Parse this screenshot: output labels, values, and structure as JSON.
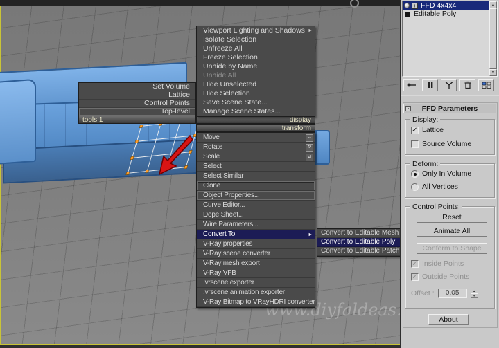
{
  "icons": {
    "submenu_arrow": "►",
    "checkmark": "✓",
    "expand_plus": "+",
    "collapse_minus": "-",
    "spinner_up": "▲",
    "spinner_down": "▼",
    "move_glyph": "↔",
    "rotate_glyph": "↻",
    "scale_glyph": "⊿"
  },
  "viewport": {
    "watermark": "www.diyfaldeas.com",
    "left_quad": {
      "header": "tools 1",
      "items": [
        "Set Volume",
        "Lattice",
        "Control Points",
        "Top-level"
      ]
    },
    "display_header": "display",
    "transform_header": "transform",
    "display_menu": [
      "Viewport Lighting and Shadows",
      "Isolate Selection",
      "Unfreeze All",
      "Freeze Selection",
      "Unhide by Name",
      "Unhide All",
      "Hide Unselected",
      "Hide Selection",
      "Save Scene State...",
      "Manage Scene States..."
    ],
    "transform_menu": [
      "Move",
      "Rotate",
      "Scale",
      "Select",
      "Select Similar",
      "Clone",
      "Object Properties...",
      "Curve Editor...",
      "Dope Sheet...",
      "Wire Parameters...",
      "Convert To:",
      "V-Ray properties",
      "V-Ray scene converter",
      "V-Ray mesh export",
      "V-Ray VFB",
      ".vrscene exporter",
      ".vrscene animation exporter",
      "V-Ray Bitmap to VRayHDRI converter"
    ],
    "convert_submenu": [
      "Convert to Editable Mesh",
      "Convert to Editable Poly",
      "Convert to Editable Patch"
    ]
  },
  "panel": {
    "stack": {
      "row1": "FFD 4x4x4",
      "row2": "Editable Poly"
    },
    "rollout_title": "FFD Parameters",
    "display_group": {
      "title": "Display:",
      "lattice": "Lattice",
      "source_volume": "Source Volume"
    },
    "deform_group": {
      "title": "Deform:",
      "only_in_volume": "Only In Volume",
      "all_vertices": "All Vertices"
    },
    "control_points_group": {
      "title": "Control Points:",
      "reset": "Reset",
      "animate_all": "Animate All",
      "conform": "Conform to Shape",
      "inside": "Inside Points",
      "outside": "Outside Points",
      "offset_label": "Offset :",
      "offset_value": "0,05"
    },
    "about": "About"
  }
}
